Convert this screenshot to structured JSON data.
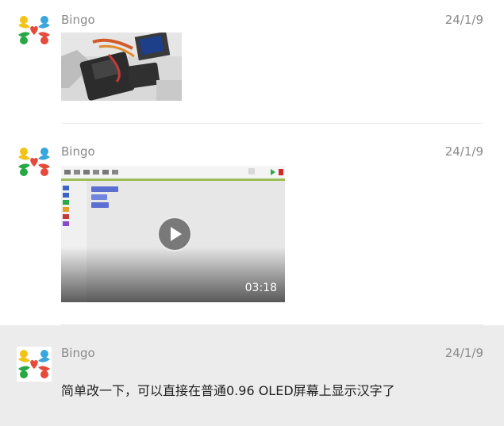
{
  "messages": [
    {
      "sender": "Bingo",
      "date": "24/1/9",
      "type": "image"
    },
    {
      "sender": "Bingo",
      "date": "24/1/9",
      "type": "video",
      "duration": "03:18"
    },
    {
      "sender": "Bingo",
      "date": "24/1/9",
      "type": "text",
      "text": "简单改一下，可以直接在普通0.96 OLED屏幕上显示汉字了"
    }
  ],
  "icons": {
    "avatar": "colorful-people-logo-icon",
    "play": "play-icon"
  },
  "colors": {
    "highlight_bg": "#ececec",
    "meta_text": "#8a8a8a"
  }
}
